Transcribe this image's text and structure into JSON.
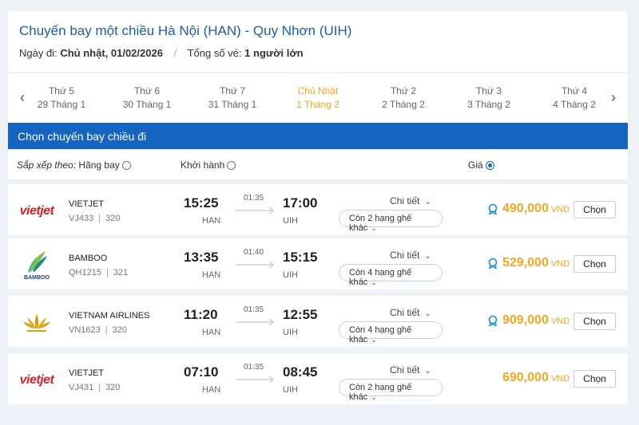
{
  "header": {
    "title": "Chuyến bay một chiều Hà Nội (HAN) - Quy Nhơn (UIH)",
    "depart_label": "Ngày đi:",
    "depart_value": "Chủ nhật, 01/02/2026",
    "tickets_label": "Tổng số vé:",
    "tickets_value": "1 người lớn"
  },
  "dates": [
    {
      "dow": "Thứ 5",
      "dm": "29 Tháng 1"
    },
    {
      "dow": "Thứ 6",
      "dm": "30 Tháng 1"
    },
    {
      "dow": "Thứ 7",
      "dm": "31 Tháng 1"
    },
    {
      "dow": "Chủ Nhật",
      "dm": "1 Tháng 2",
      "active": true
    },
    {
      "dow": "Thứ 2",
      "dm": "2 Tháng 2"
    },
    {
      "dow": "Thứ 3",
      "dm": "3 Tháng 2"
    },
    {
      "dow": "Thứ 4",
      "dm": "4 Tháng 2"
    }
  ],
  "section_title": "Chọn chuyến bay chiều đi",
  "sort": {
    "label": "Sắp xếp theo:",
    "airline": "Hãng bay",
    "departure": "Khởi hành",
    "price": "Giá"
  },
  "colors": {
    "accent": "#1565c0",
    "price": "#f5a623",
    "vietjet": "#d0232a"
  },
  "flights": [
    {
      "logo": "vietjet-logo",
      "logo_text": "vietjet",
      "airline": "VIETJET",
      "flight_no": "VJ433",
      "aircraft": "320",
      "dep_time": "15:25",
      "dep_airport": "HAN",
      "duration": "01:35",
      "arr_time": "17:00",
      "arr_airport": "UIH",
      "detail": "Chi tiết",
      "seats": "Còn 2 hạng ghế khác",
      "price": "490,000",
      "currency": "VND",
      "has_icon": true,
      "choose": "Chọn"
    },
    {
      "logo": "bamboo-logo",
      "logo_text": "BAMBOO",
      "airline": "BAMBOO",
      "flight_no": "QH1215",
      "aircraft": "321",
      "dep_time": "13:35",
      "dep_airport": "HAN",
      "duration": "01:40",
      "arr_time": "15:15",
      "arr_airport": "UIH",
      "detail": "Chi tiết",
      "seats": "Còn 4 hạng ghế khác",
      "price": "529,000",
      "currency": "VND",
      "has_icon": true,
      "choose": "Chọn"
    },
    {
      "logo": "vietnam-airlines-logo",
      "logo_text": "",
      "airline": "VIETNAM AIRLINES",
      "flight_no": "VN1623",
      "aircraft": "320",
      "dep_time": "11:20",
      "dep_airport": "HAN",
      "duration": "01:35",
      "arr_time": "12:55",
      "arr_airport": "UIH",
      "detail": "Chi tiết",
      "seats": "Còn 4 hạng ghế khác",
      "price": "909,000",
      "currency": "VND",
      "has_icon": true,
      "choose": "Chọn"
    },
    {
      "logo": "vietjet-logo",
      "logo_text": "vietjet",
      "airline": "VIETJET",
      "flight_no": "VJ431",
      "aircraft": "320",
      "dep_time": "07:10",
      "dep_airport": "HAN",
      "duration": "01:35",
      "arr_time": "08:45",
      "arr_airport": "UIH",
      "detail": "Chi tiết",
      "seats": "Còn 2 hạng ghế khác",
      "price": "690,000",
      "currency": "VND",
      "has_icon": false,
      "choose": "Chọn"
    }
  ]
}
